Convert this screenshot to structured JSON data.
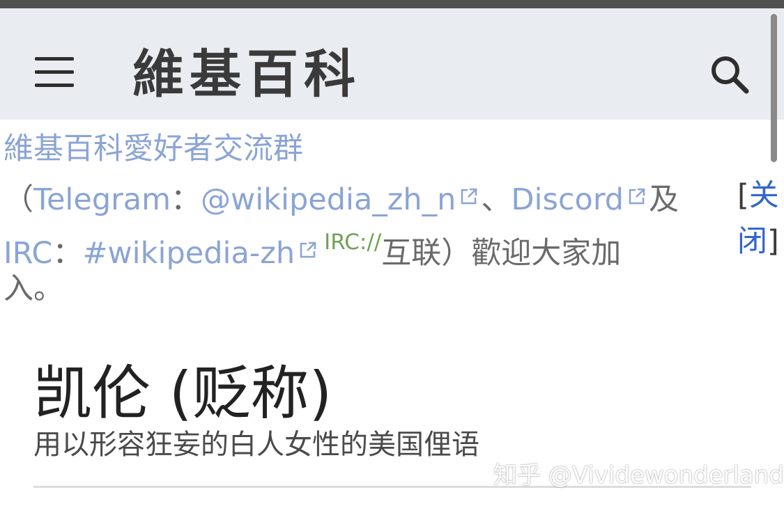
{
  "header": {
    "site_title": "維基百科",
    "menu_icon": "hamburger-menu-icon",
    "search_icon": "search-icon"
  },
  "banner": {
    "title": "維基百科愛好者交流群",
    "open_paren": "（",
    "telegram_label": "Telegram",
    "colon1": "：",
    "telegram_link": "@wikipedia_zh_n",
    "sep": "、",
    "discord_link": "Discord",
    "and": "及",
    "irc_label": "IRC",
    "colon2": "：",
    "irc_link": "#wikipedia-zh",
    "irc_tag": "IRC://",
    "after_irc": "互联）歡迎大家加",
    "line3": "入。",
    "close_open": "[",
    "close_label_1": "关",
    "close_label_2": "闭",
    "close_close": "]"
  },
  "article": {
    "title": "凯伦 (贬称)",
    "subtitle": "用以形容狂妄的白人女性的美国俚语"
  },
  "watermark": "知乎 @Vividewonderland",
  "colors": {
    "header_bg": "#e9edf1",
    "link_light": "#8aa4d6",
    "link": "#3366cc",
    "irc_tag": "#72a05a",
    "text": "#222222"
  }
}
